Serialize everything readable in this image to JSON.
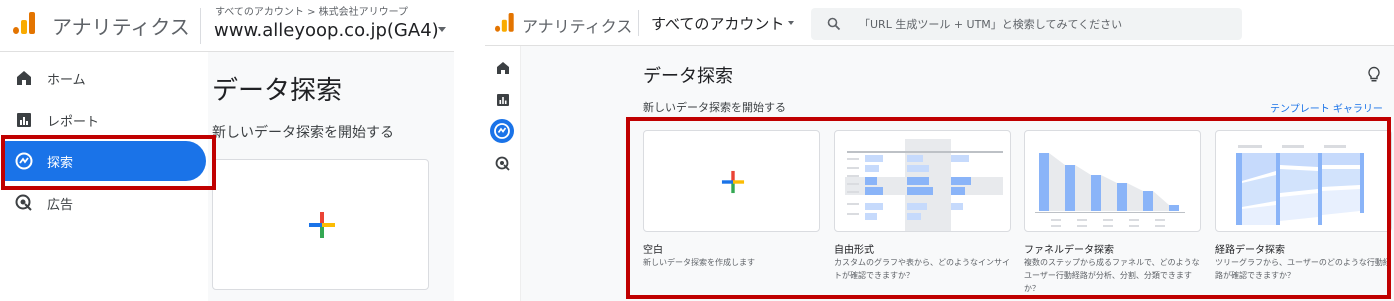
{
  "left_panel": {
    "app_title": "アナリティクス",
    "breadcrumb": "すべてのアカウント > 株式会社アリウープ",
    "property": "www.alleyoop.co.jp(GA4)",
    "nav": [
      {
        "label": "ホーム",
        "icon": "home-icon"
      },
      {
        "label": "レポート",
        "icon": "reports-icon"
      },
      {
        "label": "探索",
        "icon": "explore-icon",
        "active": true
      },
      {
        "label": "広告",
        "icon": "advertising-icon"
      }
    ],
    "page_title": "データ探索",
    "subtitle": "新しいデータ探索を開始する"
  },
  "right_panel": {
    "app_title": "アナリティクス",
    "account": "すべてのアカウント",
    "search_placeholder": "「URL 生成ツール + UTM」と検索してみてください",
    "page_title": "データ探索",
    "subtitle": "新しいデータ探索を開始する",
    "template_gallery": "テンプレート ギャラリー",
    "cards": [
      {
        "title": "空白",
        "desc": "新しいデータ探索を作成します"
      },
      {
        "title": "自由形式",
        "desc": "カスタムのグラフや表から、どのようなインサイトが確認できますか？"
      },
      {
        "title": "ファネルデータ探索",
        "desc": "複数のステップから成るファネルで、どのようなユーザー行動経路が分析、分割、分類できますか？"
      },
      {
        "title": "経路データ探索",
        "desc": "ツリーグラフから、ユーザーのどのような行動経路が確認できますか？"
      }
    ]
  },
  "colors": {
    "accent": "#1a73e8",
    "highlight_box": "#c00000",
    "logo_orange": "#e37400",
    "logo_yellow": "#f9ab00"
  }
}
